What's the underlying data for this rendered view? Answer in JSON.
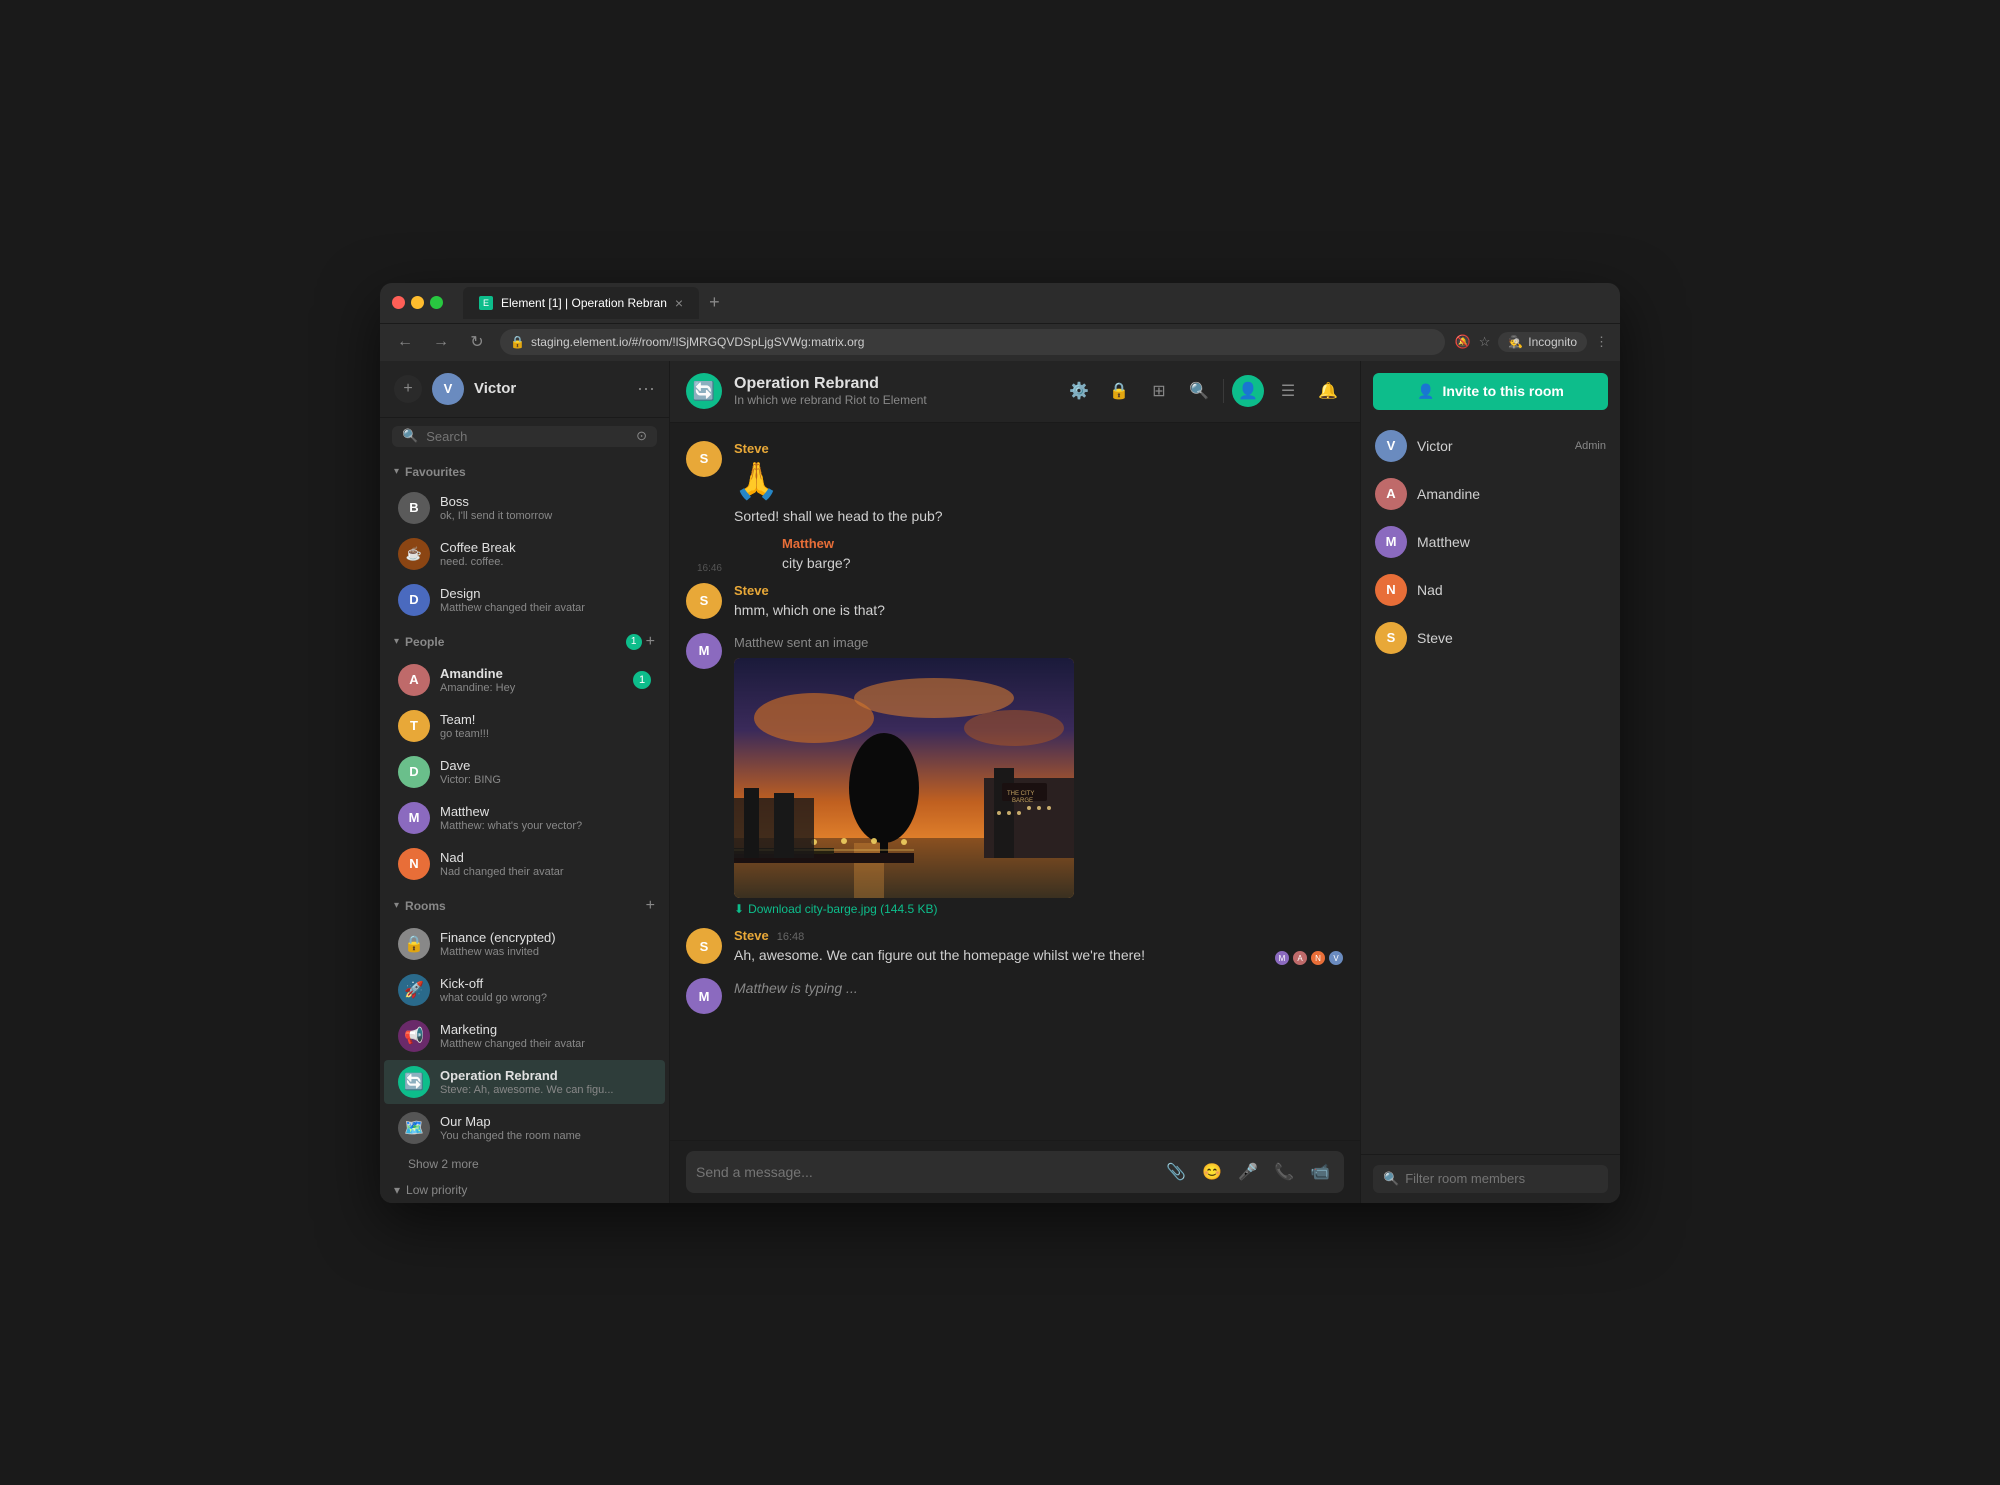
{
  "browser": {
    "url": "staging.element.io/#/room/!lSjMRGQVDSpLjgSVWg:matrix.org",
    "tab_title": "Element [1] | Operation Rebran",
    "tab_close": "×",
    "tab_add": "+",
    "incognito_label": "Incognito"
  },
  "sidebar": {
    "user_name": "Victor",
    "search_placeholder": "Search",
    "sections": {
      "favourites_label": "Favourites",
      "people_label": "People",
      "people_badge": "1",
      "rooms_label": "Rooms",
      "low_priority_label": "Low priority"
    },
    "favourites": [
      {
        "name": "Boss",
        "preview": "ok, I'll send it tomorrow",
        "color": "av-boss"
      },
      {
        "name": "Coffee Break",
        "preview": "need. coffee.",
        "color": "av-coffee"
      },
      {
        "name": "Design",
        "preview": "Matthew changed their avatar",
        "color": "av-design"
      }
    ],
    "people": [
      {
        "name": "Amandine",
        "preview": "Amandine: Hey",
        "color": "av-amandine",
        "badge": "1"
      },
      {
        "name": "Team!",
        "preview": "go team!!!",
        "color": "av-team"
      },
      {
        "name": "Dave",
        "preview": "Victor: BING",
        "color": "av-dave"
      },
      {
        "name": "Matthew",
        "preview": "Matthew: what's your vector?",
        "color": "av-matthew"
      },
      {
        "name": "Nad",
        "preview": "Nad changed their avatar",
        "color": "av-nad"
      }
    ],
    "rooms": [
      {
        "name": "Finance (encrypted)",
        "preview": "Matthew was invited",
        "color": "av-finance"
      },
      {
        "name": "Kick-off",
        "preview": "what could go wrong?",
        "color": "av-kickoff"
      },
      {
        "name": "Marketing",
        "preview": "Matthew changed their avatar",
        "color": "av-marketing"
      },
      {
        "name": "Operation Rebrand",
        "preview": "Steve: Ah, awesome. We can figu...",
        "color": "av-rebrand",
        "active": true
      },
      {
        "name": "Our Map",
        "preview": "You changed the room name",
        "color": "av-map"
      }
    ],
    "show_more": "Show 2 more"
  },
  "chat": {
    "room_name": "Operation Rebrand",
    "room_topic": "In which we rebrand Riot to Element",
    "messages": [
      {
        "sender": "Steve",
        "sender_color": "steve",
        "avatar_color": "av-steve",
        "avatar_initial": "S",
        "type": "emoji",
        "emoji": "🙏",
        "text": "Sorted! shall we head to the pub?"
      },
      {
        "sender": "Matthew",
        "sender_color": "matthew",
        "avatar_color": "av-matthew",
        "avatar_initial": "M",
        "time": "16:46",
        "type": "text",
        "text": "city barge?"
      },
      {
        "sender": "Steve",
        "sender_color": "steve",
        "avatar_color": "av-steve",
        "avatar_initial": "S",
        "type": "text",
        "text": "hmm, which one is that?"
      },
      {
        "sender": "Matthew",
        "sender_color": "matthew",
        "avatar_color": "av-matthew",
        "avatar_initial": "M",
        "type": "image",
        "image_label": "Matthew sent an image",
        "download_label": "Download city-barge.jpg (144.5 KB)"
      },
      {
        "sender": "Steve",
        "sender_color": "steve",
        "avatar_color": "av-steve",
        "avatar_initial": "S",
        "time": "16:48",
        "type": "text",
        "text": "Ah, awesome. We can figure out the homepage whilst we're there!"
      }
    ],
    "typing_indicator": "Matthew is typing ...",
    "input_placeholder": "Send a message..."
  },
  "right_panel": {
    "invite_label": "Invite to this room",
    "invite_icon": "👤",
    "members": [
      {
        "name": "Victor",
        "role": "Admin",
        "color": "av-victor",
        "initial": "V"
      },
      {
        "name": "Amandine",
        "role": "",
        "color": "av-amandine",
        "initial": "A"
      },
      {
        "name": "Matthew",
        "role": "",
        "color": "av-matthew",
        "initial": "M"
      },
      {
        "name": "Nad",
        "role": "",
        "color": "av-nad",
        "initial": "N"
      },
      {
        "name": "Steve",
        "role": "",
        "color": "av-steve",
        "initial": "S"
      }
    ],
    "filter_placeholder": "Filter room members"
  }
}
